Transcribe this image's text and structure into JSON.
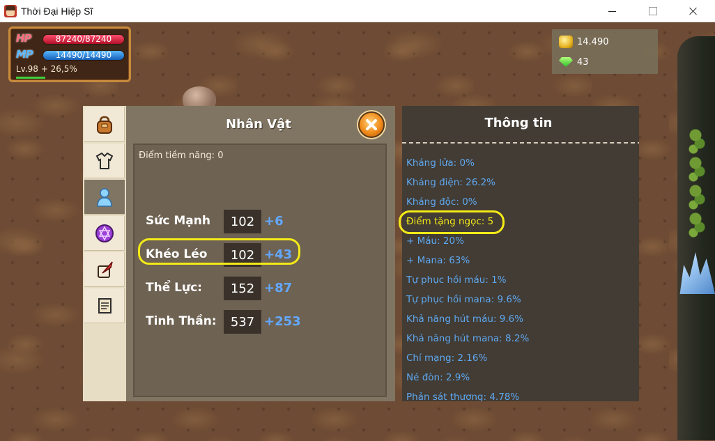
{
  "window": {
    "title": "Thời Đại Hiệp Sĩ"
  },
  "hud": {
    "hp_label": "HP",
    "hp_value": "87240/87240",
    "mp_label": "MP",
    "mp_value": "14490/14490",
    "level": "Lv.98 + 26,5%",
    "exp_fraction": 0.265,
    "gold": "14.490",
    "gems": "43"
  },
  "character_panel": {
    "title": "Nhân Vật",
    "potential_points": "Điểm tiềm năng: 0",
    "tabs": [
      {
        "icon": "bag-icon",
        "active": false
      },
      {
        "icon": "armor-icon",
        "active": false
      },
      {
        "icon": "character-icon",
        "active": true
      },
      {
        "icon": "magic-gem-icon",
        "active": false
      },
      {
        "icon": "scroll-quill-icon",
        "active": false
      },
      {
        "icon": "quest-scroll-icon",
        "active": false
      }
    ],
    "stats": [
      {
        "name": "Sức Mạnh",
        "value": "102",
        "bonus": "+6"
      },
      {
        "name": "Khéo Léo",
        "value": "102",
        "bonus": "+43"
      },
      {
        "name": "Thể Lực:",
        "value": "152",
        "bonus": "+87"
      },
      {
        "name": "Tinh Thần:",
        "value": "537",
        "bonus": "+253"
      }
    ]
  },
  "info_panel": {
    "title": "Thông tin",
    "lines": [
      "Kháng lửa: 0%",
      "Kháng điện: 26.2%",
      "Kháng độc: 0%",
      "Điểm tặng ngọc: 5",
      "+ Máu: 20%",
      "+ Mana: 63%",
      "Tự phục hồi máu: 1%",
      "Tự phục hồi mana: 9.6%",
      "Khả năng hút máu: 9.6%",
      "Khả năng hút mana: 8.2%",
      "Chí mạng: 2.16%",
      "Né đòn: 2.9%",
      "Phản sát thương: 4.78%"
    ]
  },
  "colors": {
    "highlight": "#f4ea17",
    "bonus_blue": "#63a8ff",
    "info_blue": "#5ea7f0",
    "panel_body": "#807563",
    "info_bg": "#423c34"
  }
}
